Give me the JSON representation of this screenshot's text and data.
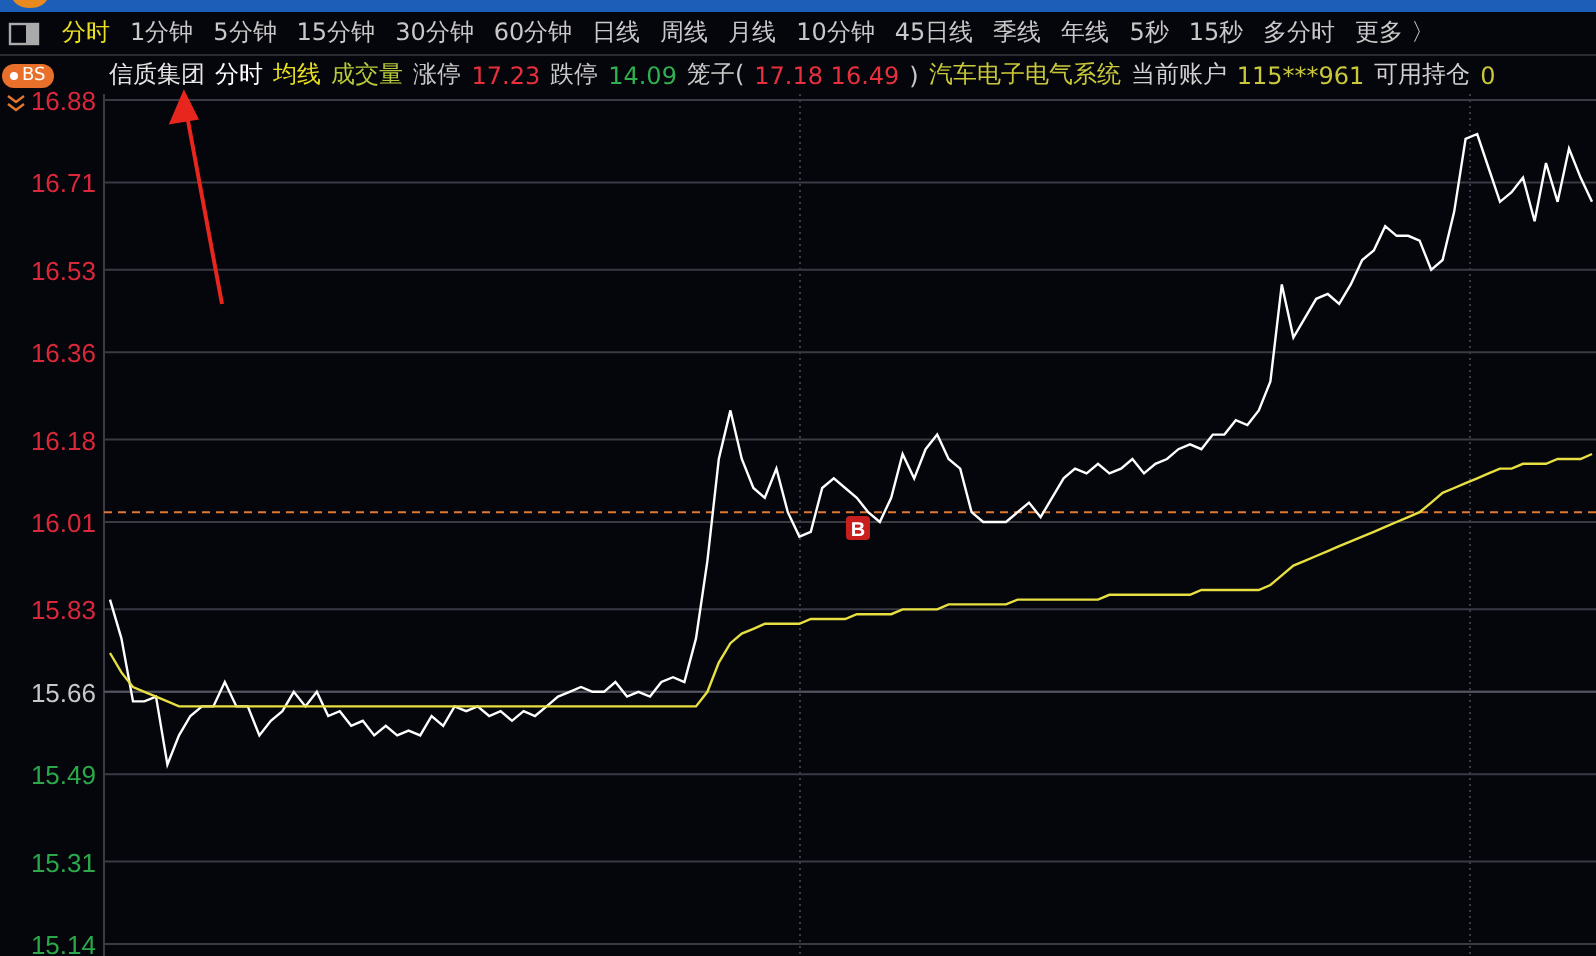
{
  "period_tabs": [
    {
      "label": "分时",
      "selected": true
    },
    {
      "label": "1分钟",
      "selected": false
    },
    {
      "label": "5分钟",
      "selected": false
    },
    {
      "label": "15分钟",
      "selected": false
    },
    {
      "label": "30分钟",
      "selected": false
    },
    {
      "label": "60分钟",
      "selected": false
    },
    {
      "label": "日线",
      "selected": false
    },
    {
      "label": "周线",
      "selected": false
    },
    {
      "label": "月线",
      "selected": false
    },
    {
      "label": "10分钟",
      "selected": false
    },
    {
      "label": "45日线",
      "selected": false
    },
    {
      "label": "季线",
      "selected": false
    },
    {
      "label": "年线",
      "selected": false
    },
    {
      "label": "5秒",
      "selected": false
    },
    {
      "label": "15秒",
      "selected": false
    },
    {
      "label": "多分时",
      "selected": false
    },
    {
      "label": "更多 〉",
      "selected": false
    }
  ],
  "bs_badge": "BS",
  "info_bar": [
    {
      "text": "信质集团",
      "color": "#e6e6e6"
    },
    {
      "text": "分时",
      "color": "#ffffff"
    },
    {
      "text": "均线",
      "color": "#e8e020"
    },
    {
      "text": "成交量",
      "color": "#b8c83a"
    },
    {
      "text": "涨停",
      "color": "#c8c8c8"
    },
    {
      "text": "17.23",
      "color": "#e8303c"
    },
    {
      "text": "跌停",
      "color": "#c8c8c8"
    },
    {
      "text": "14.09",
      "color": "#30b050"
    },
    {
      "text": "笼子(",
      "color": "#c8c8c8"
    },
    {
      "text": "17.18 16.49",
      "color": "#e8303c"
    },
    {
      "text": ")",
      "color": "#c8c8c8"
    },
    {
      "text": "汽车电子电气系统",
      "color": "#c8c83a"
    },
    {
      "text": "当前账户",
      "color": "#d0d0d0"
    },
    {
      "text": "115***961",
      "color": "#c8c83a"
    },
    {
      "text": "可用持仓",
      "color": "#d0d0d0"
    },
    {
      "text": "0",
      "color": "#c8c83a"
    }
  ],
  "buy_marker": {
    "label": "B"
  },
  "chart_data": {
    "type": "line",
    "ylim": [
      15.14,
      16.88
    ],
    "yticks": [
      {
        "value": 16.88,
        "label": "16.88"
      },
      {
        "value": 16.71,
        "label": "16.71"
      },
      {
        "value": 16.53,
        "label": "16.53"
      },
      {
        "value": 16.36,
        "label": "16.36"
      },
      {
        "value": 16.18,
        "label": "16.18"
      },
      {
        "value": 16.01,
        "label": "16.01"
      },
      {
        "value": 15.83,
        "label": "15.83"
      },
      {
        "value": 15.66,
        "label": "15.66"
      },
      {
        "value": 15.49,
        "label": "15.49"
      },
      {
        "value": 15.31,
        "label": "15.31"
      },
      {
        "value": 15.14,
        "label": "15.14"
      }
    ],
    "categories": [
      null,
      null,
      null,
      null,
      null,
      null,
      null,
      null,
      null,
      null,
      null,
      null,
      null,
      null,
      null,
      null,
      null,
      null,
      null,
      null,
      null,
      null,
      null,
      null,
      null,
      null,
      null,
      null,
      null,
      null,
      null,
      null,
      null,
      null,
      null,
      null,
      null,
      null,
      null,
      null,
      null,
      null,
      null,
      null,
      null,
      null,
      null,
      null,
      null,
      null,
      null,
      null,
      null,
      null,
      null,
      null,
      null,
      null,
      null,
      null,
      null,
      null,
      null,
      null,
      null,
      null,
      null,
      null,
      null,
      null,
      null,
      null,
      null,
      null,
      null,
      null,
      null,
      null,
      null,
      null,
      null,
      null,
      null,
      null,
      null,
      null,
      null,
      null,
      null,
      null,
      null,
      null,
      null,
      null,
      null,
      null,
      null,
      null,
      null,
      null,
      null,
      null,
      null,
      null,
      null,
      null,
      null,
      null,
      null,
      null,
      null,
      null,
      null,
      null,
      null,
      null,
      null,
      null,
      null,
      null,
      null,
      null,
      null,
      null,
      null,
      null,
      null,
      null,
      null,
      null
    ],
    "series": [
      {
        "color": "#ffffff",
        "values": [
          15.85,
          15.77,
          15.64,
          15.64,
          15.65,
          15.51,
          15.57,
          15.61,
          15.63,
          15.63,
          15.68,
          15.63,
          15.63,
          15.57,
          15.6,
          15.62,
          15.66,
          15.63,
          15.66,
          15.61,
          15.62,
          15.59,
          15.6,
          15.57,
          15.59,
          15.57,
          15.58,
          15.57,
          15.61,
          15.59,
          15.63,
          15.62,
          15.63,
          15.61,
          15.62,
          15.6,
          15.62,
          15.61,
          15.63,
          15.65,
          15.66,
          15.67,
          15.66,
          15.66,
          15.68,
          15.65,
          15.66,
          15.65,
          15.68,
          15.69,
          15.68,
          15.77,
          15.93,
          16.14,
          16.24,
          16.14,
          16.08,
          16.06,
          16.12,
          16.03,
          15.98,
          15.99,
          16.08,
          16.1,
          16.08,
          16.06,
          16.03,
          16.01,
          16.06,
          16.15,
          16.1,
          16.16,
          16.19,
          16.14,
          16.12,
          16.03,
          16.01,
          16.01,
          16.01,
          16.03,
          16.05,
          16.02,
          16.06,
          16.1,
          16.12,
          16.11,
          16.13,
          16.11,
          16.12,
          16.14,
          16.11,
          16.13,
          16.14,
          16.16,
          16.17,
          16.16,
          16.19,
          16.19,
          16.22,
          16.21,
          16.24,
          16.3,
          16.5,
          16.39,
          16.43,
          16.47,
          16.48,
          16.46,
          16.5,
          16.55,
          16.57,
          16.62,
          16.6,
          16.6,
          16.59,
          16.53,
          16.55,
          16.65,
          16.8,
          16.81,
          16.74,
          16.67,
          16.69,
          16.72,
          16.63,
          16.75,
          16.67,
          16.78,
          16.72,
          16.67
        ]
      },
      {
        "color": "#e8e040",
        "values": [
          15.74,
          15.7,
          15.67,
          15.66,
          15.65,
          15.64,
          15.63,
          15.63,
          15.63,
          15.63,
          15.63,
          15.63,
          15.63,
          15.63,
          15.63,
          15.63,
          15.63,
          15.63,
          15.63,
          15.63,
          15.63,
          15.63,
          15.63,
          15.63,
          15.63,
          15.63,
          15.63,
          15.63,
          15.63,
          15.63,
          15.63,
          15.63,
          15.63,
          15.63,
          15.63,
          15.63,
          15.63,
          15.63,
          15.63,
          15.63,
          15.63,
          15.63,
          15.63,
          15.63,
          15.63,
          15.63,
          15.63,
          15.63,
          15.63,
          15.63,
          15.63,
          15.63,
          15.66,
          15.72,
          15.76,
          15.78,
          15.79,
          15.8,
          15.8,
          15.8,
          15.8,
          15.81,
          15.81,
          15.81,
          15.81,
          15.82,
          15.82,
          15.82,
          15.82,
          15.83,
          15.83,
          15.83,
          15.83,
          15.84,
          15.84,
          15.84,
          15.84,
          15.84,
          15.84,
          15.85,
          15.85,
          15.85,
          15.85,
          15.85,
          15.85,
          15.85,
          15.85,
          15.86,
          15.86,
          15.86,
          15.86,
          15.86,
          15.86,
          15.86,
          15.86,
          15.87,
          15.87,
          15.87,
          15.87,
          15.87,
          15.87,
          15.88,
          15.9,
          15.92,
          15.93,
          15.94,
          15.95,
          15.96,
          15.97,
          15.98,
          15.99,
          16.0,
          16.01,
          16.02,
          16.03,
          16.05,
          16.07,
          16.08,
          16.09,
          16.1,
          16.11,
          16.12,
          16.12,
          16.13,
          16.13,
          16.13,
          16.14,
          16.14,
          16.14,
          16.15
        ]
      }
    ],
    "grid": true,
    "ref_lines": [
      {
        "axis": "y",
        "value": 16.03,
        "color": "#e07830"
      },
      {
        "axis": "y",
        "value": 15.66,
        "color": "#55555f"
      }
    ]
  }
}
